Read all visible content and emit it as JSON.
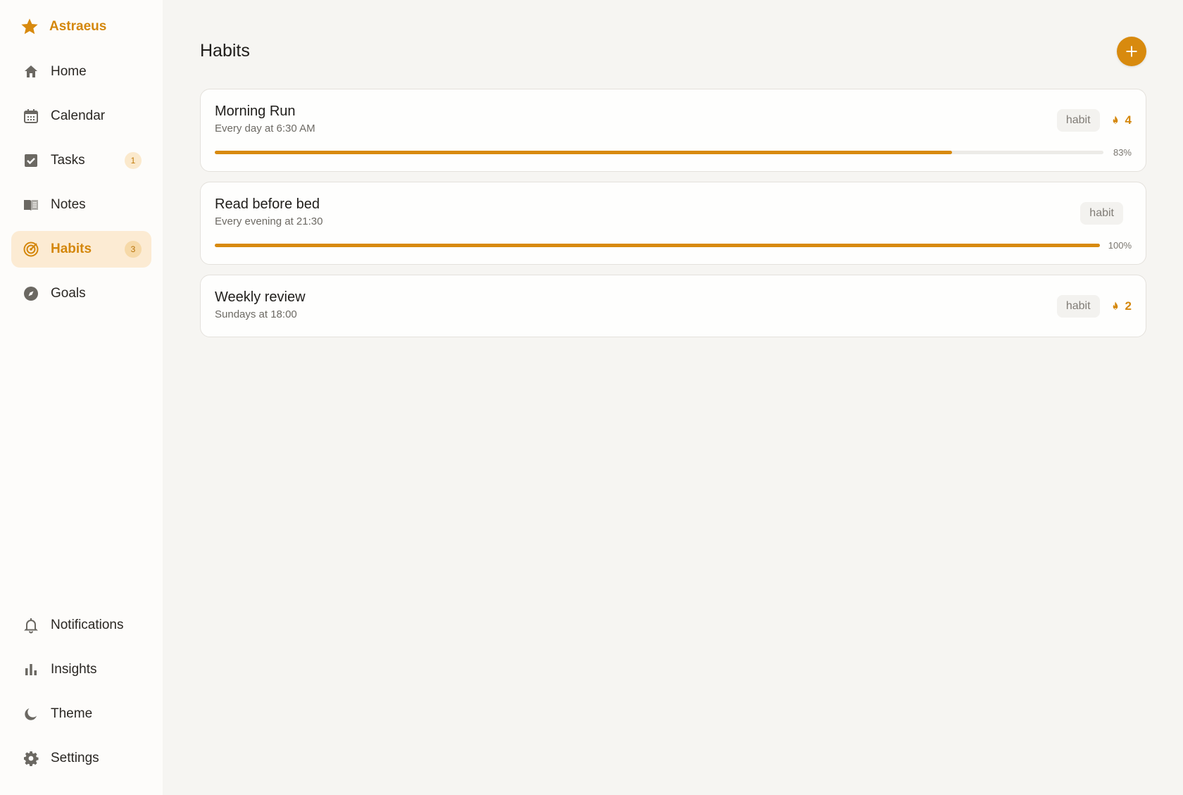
{
  "brand": {
    "name": "Astraeus",
    "icon": "star-icon"
  },
  "nav": {
    "items": [
      {
        "label": "Home",
        "icon": "home-icon"
      },
      {
        "label": "Calendar",
        "icon": "calendar-icon"
      },
      {
        "label": "Tasks",
        "icon": "checkbox-icon",
        "badge": "1"
      },
      {
        "label": "Notes",
        "icon": "book-icon"
      },
      {
        "label": "Habits",
        "icon": "target-icon",
        "badge": "3",
        "active": true
      },
      {
        "label": "Goals",
        "icon": "compass-icon"
      }
    ],
    "bottom": [
      {
        "label": "Notifications",
        "icon": "bell-icon"
      },
      {
        "label": "Insights",
        "icon": "bar-chart-icon"
      },
      {
        "label": "Theme",
        "icon": "moon-icon"
      },
      {
        "label": "Settings",
        "icon": "gear-icon"
      }
    ]
  },
  "page": {
    "title": "Habits",
    "add_icon": "plus-icon"
  },
  "habits": [
    {
      "title": "Morning Run",
      "schedule": "Every day at 6:30 AM",
      "tag": "habit",
      "streak": "4",
      "progress": 0.83,
      "progress_label": "83%"
    },
    {
      "title": "Read before bed",
      "schedule": "Every evening at 21:30",
      "tag": "habit",
      "streak": "",
      "progress": 1.0,
      "progress_label": "100%"
    },
    {
      "title": "Weekly review",
      "schedule": "Sundays at 18:00",
      "tag": "habit",
      "streak": "2"
    }
  ],
  "colors": {
    "accent": "#d88a0e",
    "active_bg": "#fcebd3",
    "badge_bg": "#fbe9cc"
  }
}
